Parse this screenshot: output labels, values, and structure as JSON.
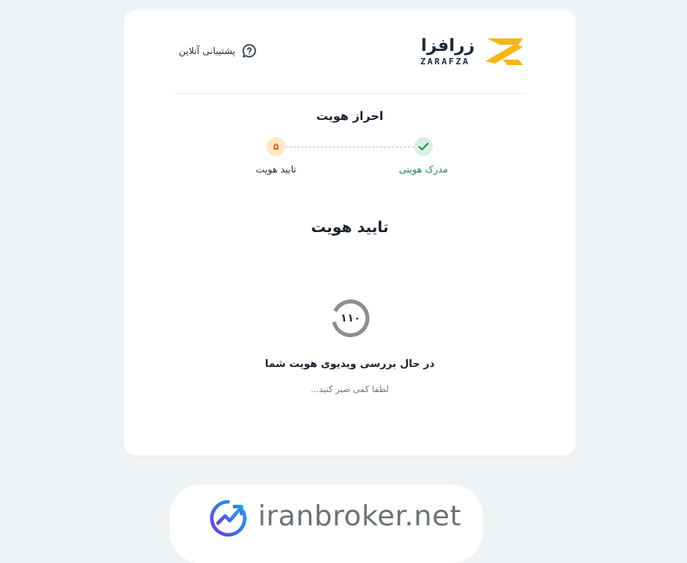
{
  "header": {
    "logo_fa": "زرافزا",
    "logo_en": "ZARAFZA",
    "support_label": "پشتیبانی آنلاین"
  },
  "stepper": {
    "title": "احراز هویت",
    "steps": [
      {
        "label": "مدرک هویتی",
        "status": "done"
      },
      {
        "label": "تایید هویت",
        "status": "current",
        "number": "۵"
      }
    ]
  },
  "main": {
    "heading": "تایید هویت",
    "timer_value": "۱۱۰",
    "status_text": "در حال بررسی ویدیوی هویت شما",
    "hint_text": "لطفا کمی صبر کنید..."
  },
  "watermark": {
    "text": "iranbroker.net"
  },
  "colors": {
    "background": "#f0f3f6",
    "brand_yellow": "#f7b518",
    "success": "#1f8a4f",
    "warning": "#e0651e"
  }
}
